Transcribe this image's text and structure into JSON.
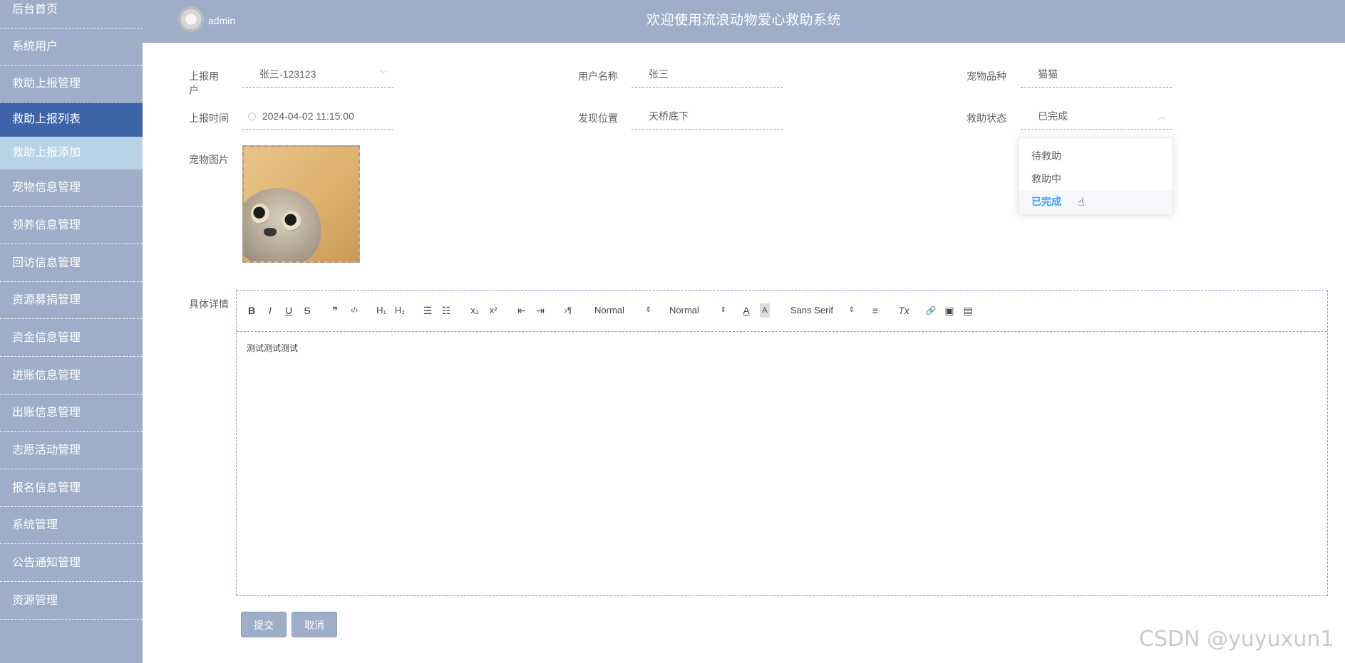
{
  "header": {
    "title": "欢迎使用流浪动物爱心救助系统",
    "admin_name": "admin"
  },
  "sidebar": {
    "items": [
      {
        "label": "后台首页"
      },
      {
        "label": "系统用户"
      },
      {
        "label": "救助上报管理"
      },
      {
        "label": "救助上报列表"
      },
      {
        "label": "救助上报添加"
      },
      {
        "label": "宠物信息管理"
      },
      {
        "label": "领养信息管理"
      },
      {
        "label": "回访信息管理"
      },
      {
        "label": "资源募捐管理"
      },
      {
        "label": "资金信息管理"
      },
      {
        "label": "进账信息管理"
      },
      {
        "label": "出账信息管理"
      },
      {
        "label": "志愿活动管理"
      },
      {
        "label": "报名信息管理"
      },
      {
        "label": "系统管理"
      },
      {
        "label": "公告通知管理"
      },
      {
        "label": "资源管理"
      }
    ]
  },
  "form": {
    "report_user": {
      "label": "上报用户",
      "value": "张三-123123"
    },
    "user_name": {
      "label": "用户名称",
      "value": "张三"
    },
    "pet_breed": {
      "label": "宠物品种",
      "value": "猫猫"
    },
    "report_time": {
      "label": "上报时间",
      "value": "2024-04-02 11:15:00"
    },
    "location": {
      "label": "发现位置",
      "value": "天桥底下"
    },
    "rescue_status": {
      "label": "救助状态",
      "value": "已完成"
    },
    "pet_image": {
      "label": "宠物图片"
    },
    "details": {
      "label": "具体详情",
      "content": "测试测试测试"
    }
  },
  "status_dropdown": {
    "options": [
      "待救助",
      "救助中",
      "已完成"
    ],
    "selected": "已完成"
  },
  "editor_toolbar": {
    "bold": "B",
    "italic": "I",
    "underline": "U",
    "strike": "S",
    "blockquote": "❞",
    "code": "‹/›",
    "h1": "H₁",
    "h2": "H₂",
    "ordered_list": "☰",
    "bullet_list": "☷",
    "subscript": "x₂",
    "superscript": "x²",
    "outdent": "⇤",
    "indent": "⇥",
    "direction": "›¶",
    "size_select": "Normal",
    "header_select": "Normal",
    "font_color": "A",
    "background": "A",
    "font_select": "Sans Serif",
    "align": "≡",
    "clean": "Tx",
    "link": "🔗",
    "image": "▣",
    "video": "▤"
  },
  "buttons": {
    "submit": "提交",
    "cancel": "取消"
  },
  "watermark": "CSDN @yuyuxun1",
  "colors": {
    "sidebar_bg": "#9eadc8",
    "active_item": "#3d63a8",
    "sub_item": "#b9d3e6",
    "selected_option": "#409eff"
  }
}
